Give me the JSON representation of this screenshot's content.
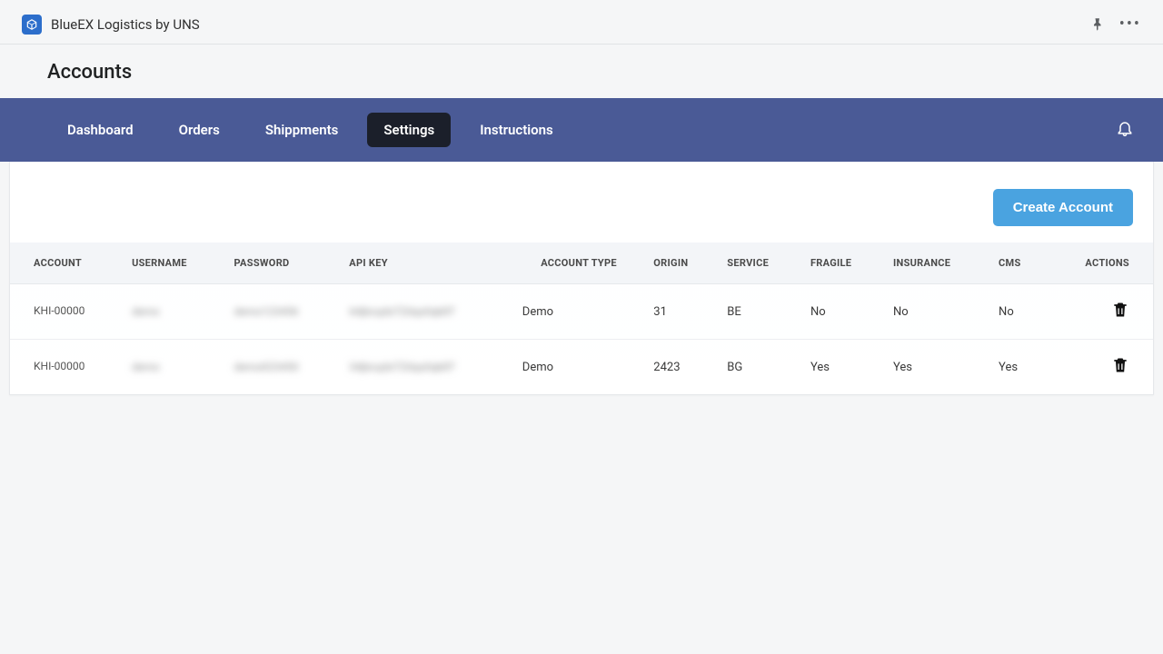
{
  "app": {
    "title": "BlueEX Logistics by UNS"
  },
  "page": {
    "heading": "Accounts"
  },
  "nav": {
    "tabs": [
      {
        "label": "Dashboard",
        "active": false
      },
      {
        "label": "Orders",
        "active": false
      },
      {
        "label": "Shippments",
        "active": false
      },
      {
        "label": "Settings",
        "active": true
      },
      {
        "label": "Instructions",
        "active": false
      }
    ]
  },
  "actions": {
    "create_label": "Create Account"
  },
  "table": {
    "headers": {
      "account": "ACCOUNT",
      "username": "USERNAME",
      "password": "PASSWORD",
      "api_key": "API KEY",
      "account_type": "ACCOUNT TYPE",
      "origin": "ORIGIN",
      "service": "SERVICE",
      "fragile": "FRAGILE",
      "insurance": "INSURANCE",
      "cms": "CMS",
      "actions": "ACTIONS"
    },
    "rows": [
      {
        "account": "KHI-00000",
        "username": "demo",
        "password": "demo123456",
        "api_key": "64jbcqdsTZdqs0qk8T",
        "account_type": "Demo",
        "origin": "31",
        "service": "BE",
        "fragile": "No",
        "insurance": "No",
        "cms": "No"
      },
      {
        "account": "KHI-00000",
        "username": "demo",
        "password": "demo023450",
        "api_key": "34jbcqdsTZdqs0qk8T",
        "account_type": "Demo",
        "origin": "2423",
        "service": "BG",
        "fragile": "Yes",
        "insurance": "Yes",
        "cms": "Yes"
      }
    ]
  }
}
